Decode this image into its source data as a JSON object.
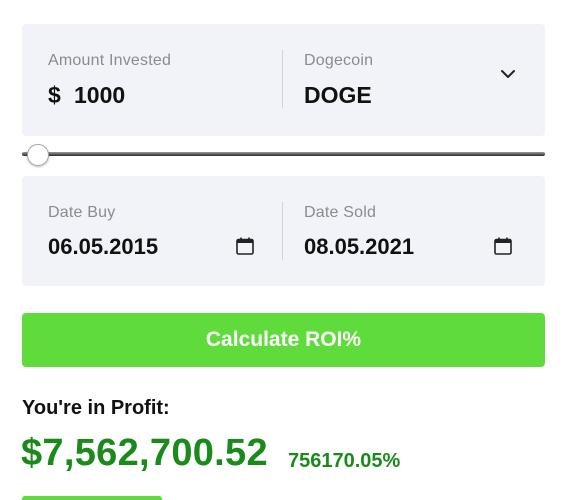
{
  "investment": {
    "amount_label": "Amount Invested",
    "currency_symbol": "$",
    "amount_value": "1000",
    "coin_label": "Dogecoin",
    "coin_value": "DOGE",
    "coin_dropdown_icon": "chevron-down-icon"
  },
  "slider": {
    "fraction": 0.0
  },
  "dates": {
    "buy_label": "Date Buy",
    "buy_value": "06.05.2015",
    "sold_label": "Date Sold",
    "sold_value": "08.05.2021",
    "calendar_icon": "calendar-icon"
  },
  "actions": {
    "calculate_label": "Calculate ROI%"
  },
  "result": {
    "heading": "You're in Profit:",
    "amount": "$7,562,700.52",
    "percent": "756170.05%"
  },
  "colors": {
    "accent_green": "#5fdb3b",
    "profit_green": "#1a8b1a",
    "panel_bg": "#f1f3f8"
  }
}
